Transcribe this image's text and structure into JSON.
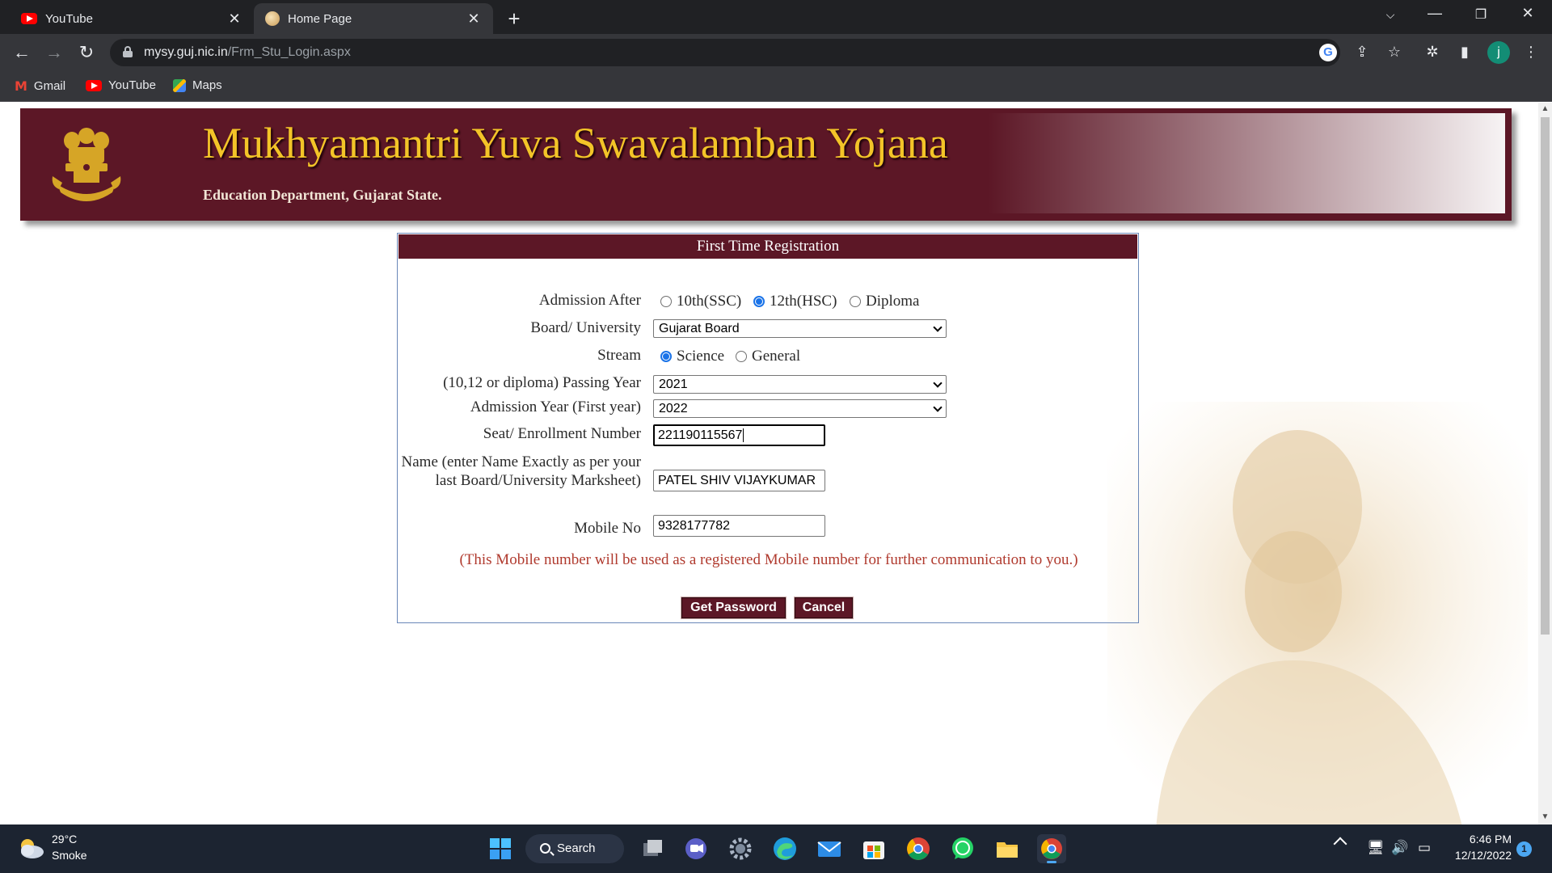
{
  "browser": {
    "tabs": [
      {
        "title": "YouTube",
        "icon": "youtube-icon"
      },
      {
        "title": "Home Page",
        "icon": "site-favicon"
      }
    ],
    "address": {
      "domain": "mysy.guj.nic.in",
      "path": "/Frm_Stu_Login.aspx"
    },
    "profile_initial": "j",
    "bookmarks": [
      {
        "label": "Gmail",
        "icon": "gmail-icon"
      },
      {
        "label": "YouTube",
        "icon": "youtube-icon"
      },
      {
        "label": "Maps",
        "icon": "maps-icon"
      }
    ]
  },
  "site": {
    "title": "Mukhyamantri Yuva Swavalamban Yojana",
    "subtitle": "Education Department, Gujarat State.",
    "colors": {
      "maroon": "#5c1726",
      "title_gold": "#f3c428"
    }
  },
  "form": {
    "heading": "First Time Registration",
    "admission_after": {
      "label": "Admission After",
      "options": [
        "10th(SSC)",
        "12th(HSC)",
        "Diploma"
      ],
      "selected": "12th(HSC)"
    },
    "board": {
      "label": "Board/ University",
      "value": "Gujarat Board"
    },
    "stream": {
      "label": "Stream",
      "options": [
        "Science",
        "General"
      ],
      "selected": "Science"
    },
    "passing_year": {
      "label": "(10,12 or diploma) Passing Year",
      "value": "2021"
    },
    "admission_year": {
      "label": "Admission Year (First year)",
      "value": "2022"
    },
    "seat_number": {
      "label": "Seat/ Enrollment Number",
      "value": "221190115567"
    },
    "name": {
      "label": "Name (enter Name Exactly as per your last Board/University Marksheet)",
      "value": "PATEL SHIV VIJAYKUMAR"
    },
    "mobile": {
      "label": "Mobile No",
      "value": "9328177782"
    },
    "note": "(This Mobile number will be used as a registered Mobile number for further communication to you.)",
    "buttons": {
      "get_password": "Get Password",
      "cancel": "Cancel"
    }
  },
  "taskbar": {
    "weather": {
      "temp": "29°C",
      "desc": "Smoke"
    },
    "search_label": "Search",
    "time": "6:46 PM",
    "date": "12/12/2022",
    "notification_count": "1"
  }
}
